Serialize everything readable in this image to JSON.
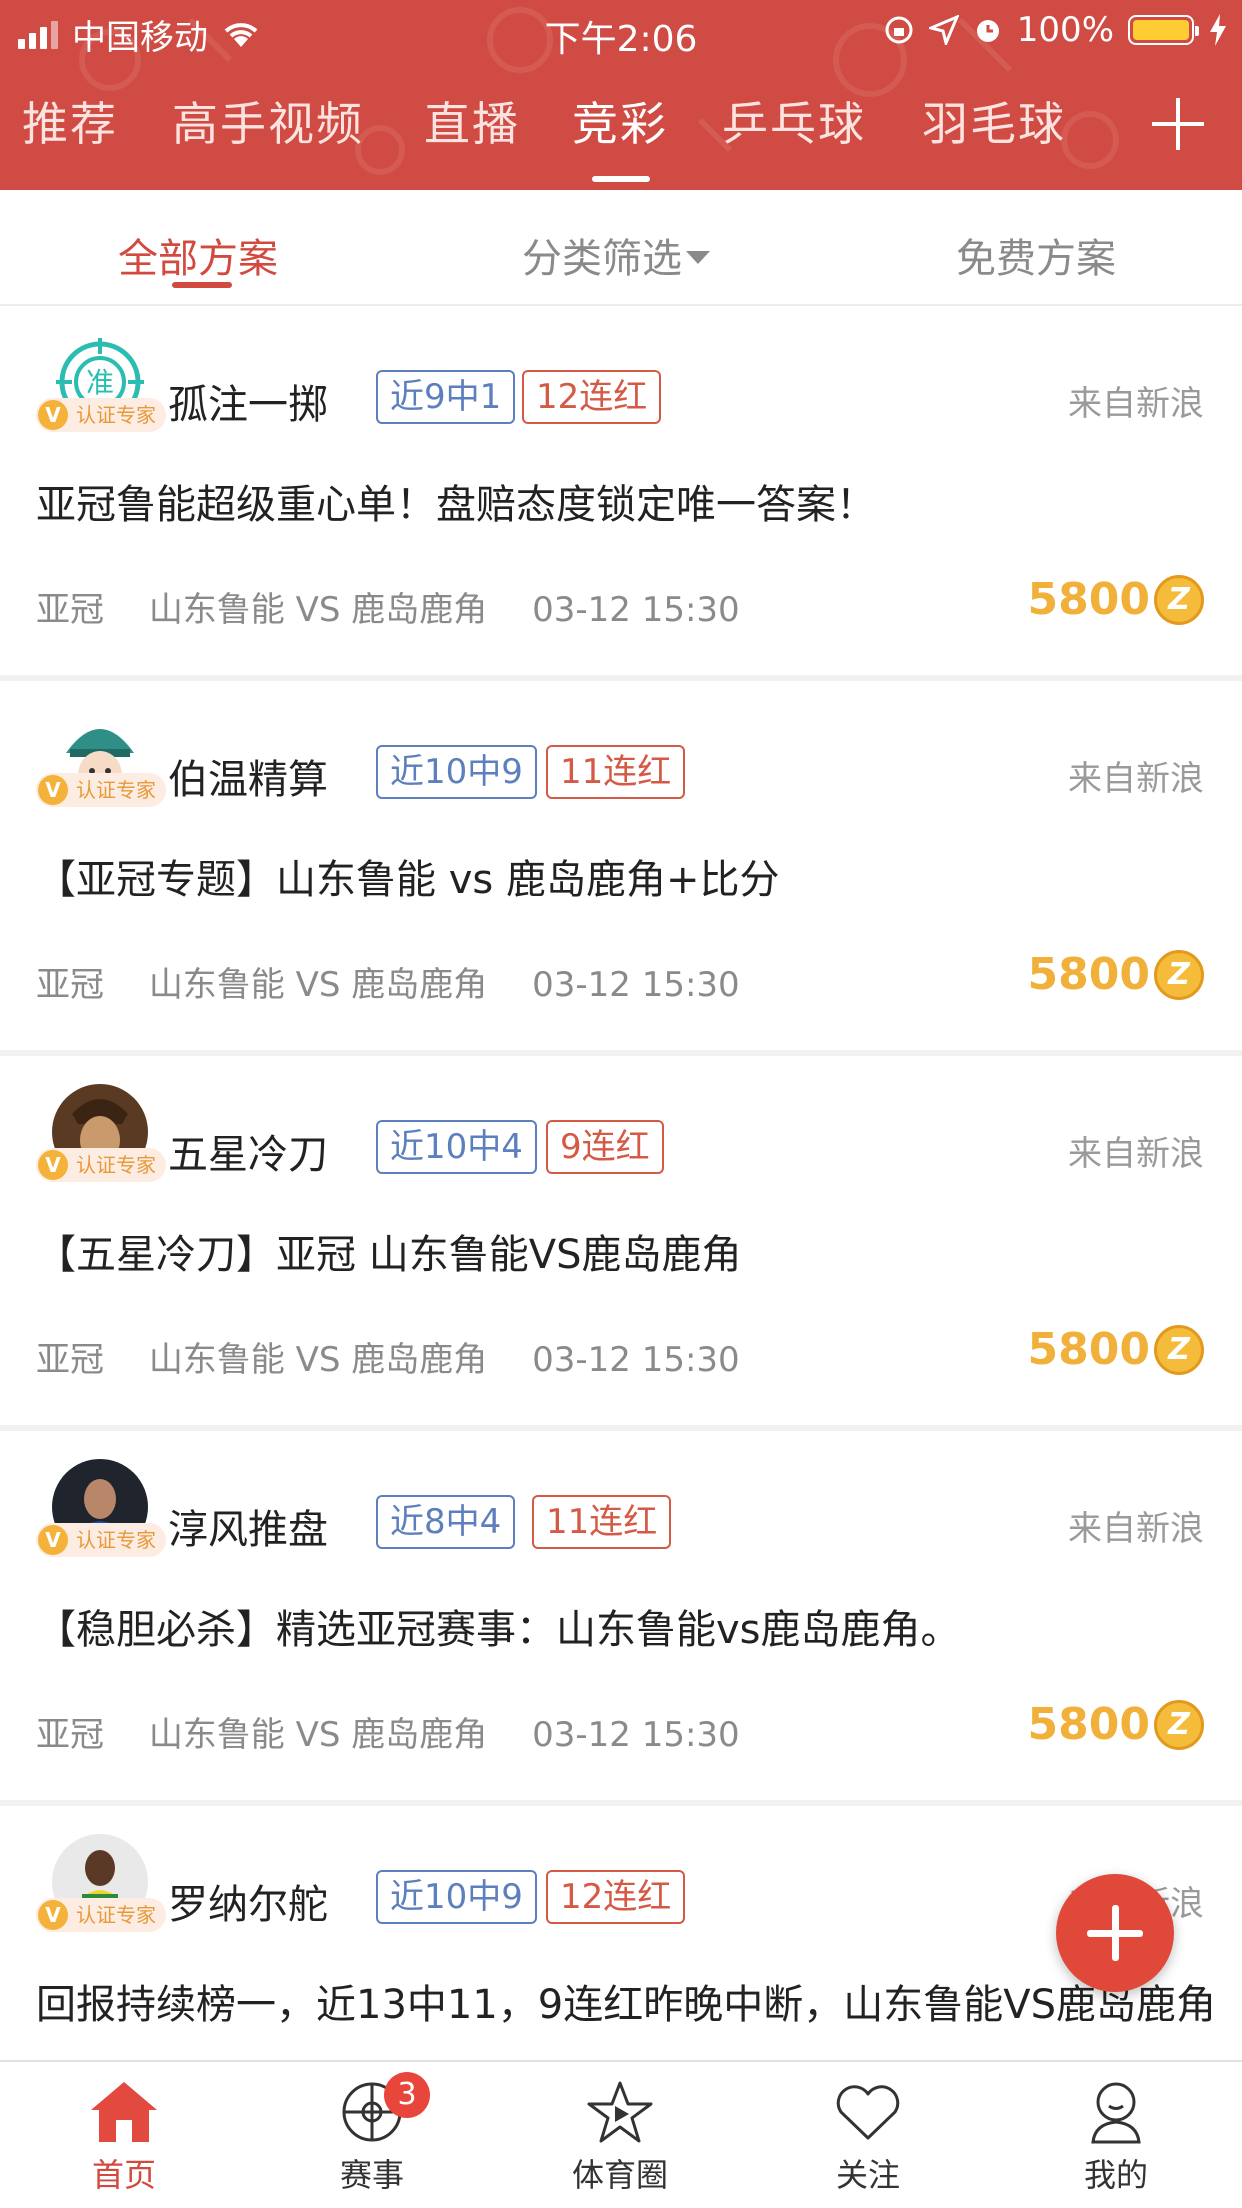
{
  "status_bar": {
    "carrier": "中国移动",
    "time": "下午2:06",
    "battery": "100%"
  },
  "top_tabs": [
    "推荐",
    "高手视频",
    "直播",
    "竞彩",
    "乒乓球",
    "羽毛球"
  ],
  "top_tabs_active": "竞彩",
  "sub_tabs": {
    "all": "全部方案",
    "filter": "分类筛选",
    "free": "免费方案"
  },
  "cert_label": "认证专家",
  "v_mark": "V",
  "coin_mark": "Z",
  "posts": [
    {
      "author": "孤注一掷",
      "record": "近9中1",
      "streak": "12连红",
      "source": "来自新浪",
      "title": "亚冠鲁能超级重心单！盘赔态度锁定唯一答案！",
      "league": "亚冠",
      "match": "山东鲁能 VS 鹿岛鹿角",
      "time": "03-12 15:30",
      "price": "5800",
      "avatar_text": "准"
    },
    {
      "author": "伯温精算",
      "record": "近10中9",
      "streak": "11连红",
      "source": "来自新浪",
      "title": "【亚冠专题】山东鲁能 vs 鹿岛鹿角+比分",
      "league": "亚冠",
      "match": "山东鲁能 VS 鹿岛鹿角",
      "time": "03-12 15:30",
      "price": "5800"
    },
    {
      "author": "五星冷刀",
      "record": "近10中4",
      "streak": "9连红",
      "source": "来自新浪",
      "title": "【五星冷刀】亚冠 山东鲁能VS鹿岛鹿角",
      "league": "亚冠",
      "match": "山东鲁能 VS 鹿岛鹿角",
      "time": "03-12 15:30",
      "price": "5800"
    },
    {
      "author": "淳风推盘",
      "record": "近8中4",
      "streak": "11连红",
      "source": "来自新浪",
      "title": "【稳胆必杀】精选亚冠赛事：山东鲁能vs鹿岛鹿角。",
      "league": "亚冠",
      "match": "山东鲁能 VS 鹿岛鹿角",
      "time": "03-12 15:30",
      "price": "5800"
    },
    {
      "author": "罗纳尔舵",
      "record": "近10中9",
      "streak": "12连红",
      "source": "来自新浪",
      "title": "回报持续榜一，近13中11，9连红昨晚中断，山东鲁能VS鹿岛鹿角"
    }
  ],
  "bottom_nav": [
    {
      "label": "首页",
      "icon": "home-icon",
      "active": true
    },
    {
      "label": "赛事",
      "icon": "match-icon",
      "badge": "3"
    },
    {
      "label": "体育圈",
      "icon": "star-play-icon"
    },
    {
      "label": "关注",
      "icon": "heart-icon"
    },
    {
      "label": "我的",
      "icon": "profile-icon"
    }
  ],
  "colors": {
    "header_red": "#cf4b43",
    "accent_red": "#d24a3f",
    "record_blue": "#5d7fbd",
    "streak_red": "#d45a45",
    "price_gold": "#f0b03a"
  }
}
